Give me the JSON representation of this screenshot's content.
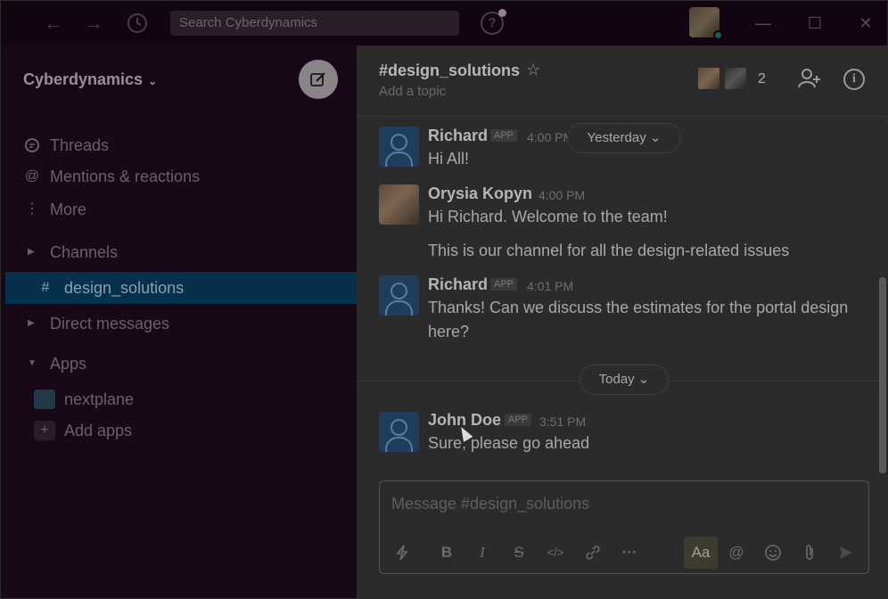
{
  "titlebar": {
    "search_placeholder": "Search Cyberdynamics",
    "back_icon": "←",
    "forward_icon": "→",
    "history_icon": "🕓",
    "help_icon": "?",
    "minimize_icon": "—",
    "maximize_icon": "☐",
    "close_icon": "✕"
  },
  "sidebar": {
    "workspace": "Cyberdynamics",
    "compose_icon": "✎",
    "items": [
      {
        "icon": "💬",
        "label": "Threads"
      },
      {
        "icon": "@",
        "label": "Mentions & reactions"
      },
      {
        "icon": "⋮",
        "label": "More"
      }
    ],
    "channels_header": "Channels",
    "active_channel": "design_solutions",
    "dm_header": "Direct messages",
    "apps_header": "Apps",
    "apps": [
      {
        "label": "nextplane"
      },
      {
        "label": "Add apps"
      }
    ]
  },
  "channel": {
    "name": "#design_solutions",
    "topic": "Add a topic",
    "member_count": "2"
  },
  "messages": [
    {
      "author": "Richard",
      "app": "APP",
      "time": "4:00 PM",
      "text": "Hi All!"
    },
    {
      "author": "Orysia Kopyn",
      "time": "4:00 PM",
      "text": "Hi Richard. Welcome to the team!",
      "text2": "This is our channel for all the design-related issues"
    },
    {
      "author": "Richard",
      "app": "APP",
      "time": "4:01 PM",
      "text": "Thanks! Can we discuss the estimates for the portal design here?"
    },
    {
      "author": "John Doe",
      "app": "APP",
      "time": "3:51 PM",
      "text": "Sure, please go ahead"
    }
  ],
  "day_dividers": {
    "yesterday": "Yesterday ⌄",
    "today": "Today ⌄"
  },
  "composer": {
    "placeholder": "Message #design_solutions",
    "aa_label": "Aa"
  },
  "colors": {
    "sidebar_bg": "#190818",
    "active_item": "#06314c",
    "main_bg": "#2b2b2b"
  }
}
